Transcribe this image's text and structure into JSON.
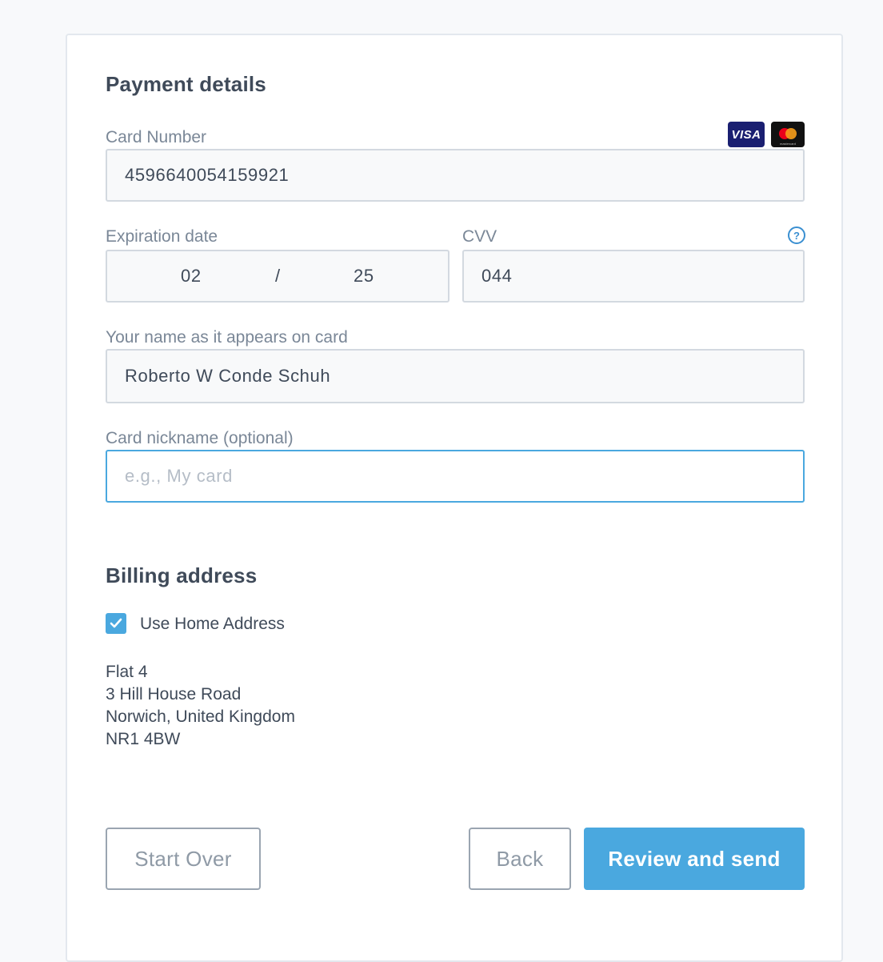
{
  "payment": {
    "title": "Payment details",
    "card_number_label": "Card Number",
    "card_number_value": "4596640054159921",
    "card_brands": [
      "visa-icon",
      "mastercard-icon"
    ],
    "visa_text": "VISA",
    "expiration_label": "Expiration date",
    "exp_month": "02",
    "exp_separator": "/",
    "exp_year": "25",
    "cvv_label": "CVV",
    "cvv_value": "044",
    "cvv_help_icon": "?",
    "name_label": "Your name as it appears on card",
    "name_value": "Roberto W Conde Schuh",
    "nickname_label": "Card nickname (optional)",
    "nickname_placeholder": "e.g., My card"
  },
  "billing": {
    "title": "Billing address",
    "use_home_label": "Use Home Address",
    "use_home_checked": true,
    "address_lines": [
      "Flat 4",
      "3 Hill House Road",
      "Norwich, United Kingdom",
      "NR1 4BW"
    ]
  },
  "actions": {
    "start_over": "Start Over",
    "back": "Back",
    "review_send": "Review and send"
  },
  "colors": {
    "accent": "#4aa8df",
    "text": "#3f4a59",
    "label": "#7a8797"
  }
}
